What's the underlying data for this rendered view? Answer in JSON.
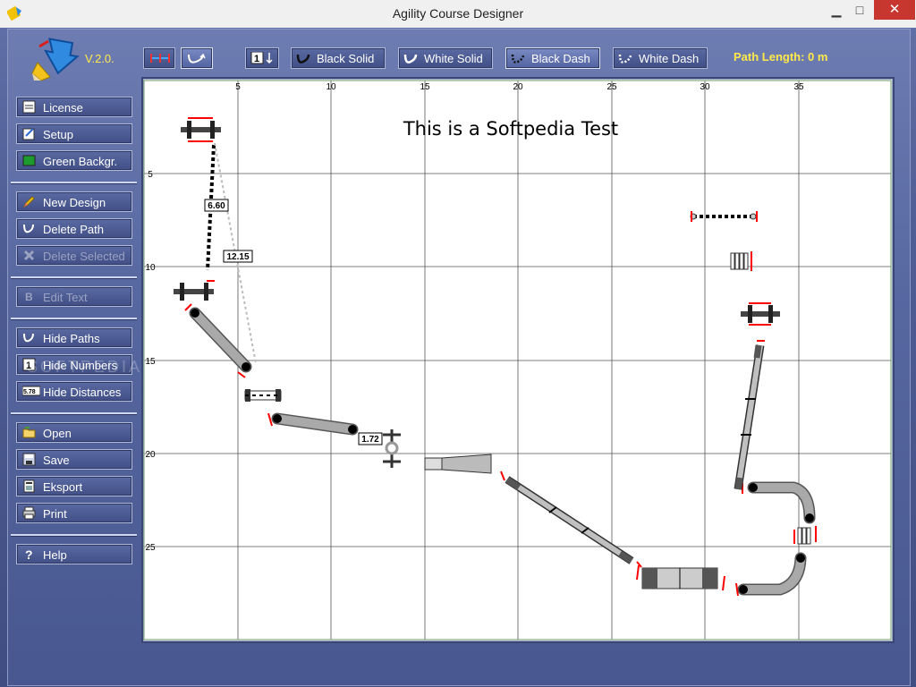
{
  "window": {
    "title": "Agility Course Designer",
    "minimize": "▁",
    "maximize": "□",
    "close": "✕"
  },
  "app": {
    "version": "V.2.0."
  },
  "sidebar": {
    "license": "License",
    "setup": "Setup",
    "green_background": "Green Backgr.",
    "new_design": "New Design",
    "delete_path": "Delete Path",
    "delete_selected": "Delete Selected",
    "edit_text": "Edit Text",
    "hide_paths": "Hide Paths",
    "hide_numbers": "Hide Numbers",
    "hide_distances": "Hide Distances",
    "hide_distances_icon_text": "5.78",
    "open": "Open",
    "save": "Save",
    "export": "Eksport",
    "print": "Print",
    "help": "Help"
  },
  "toolbar": {
    "numbering_icon_text": "1",
    "black_solid": "Black Solid",
    "white_solid": "White Solid",
    "black_dash": "Black Dash",
    "white_dash": "White Dash",
    "path_length": "Path Length: 0 m"
  },
  "canvas": {
    "title": "This is a Softpedia Test",
    "x_ticks": [
      "5",
      "10",
      "15",
      "20",
      "25",
      "30",
      "35"
    ],
    "y_ticks": [
      "5",
      "10",
      "15",
      "20",
      "25"
    ],
    "distance_labels": [
      "6.60",
      "12.15",
      "1.72"
    ]
  },
  "colors": {
    "accent_yellow": "#ffe94a",
    "grid": "#000000",
    "cone_red": "#ff0000",
    "equipment_gray": "#a9a9a9"
  }
}
